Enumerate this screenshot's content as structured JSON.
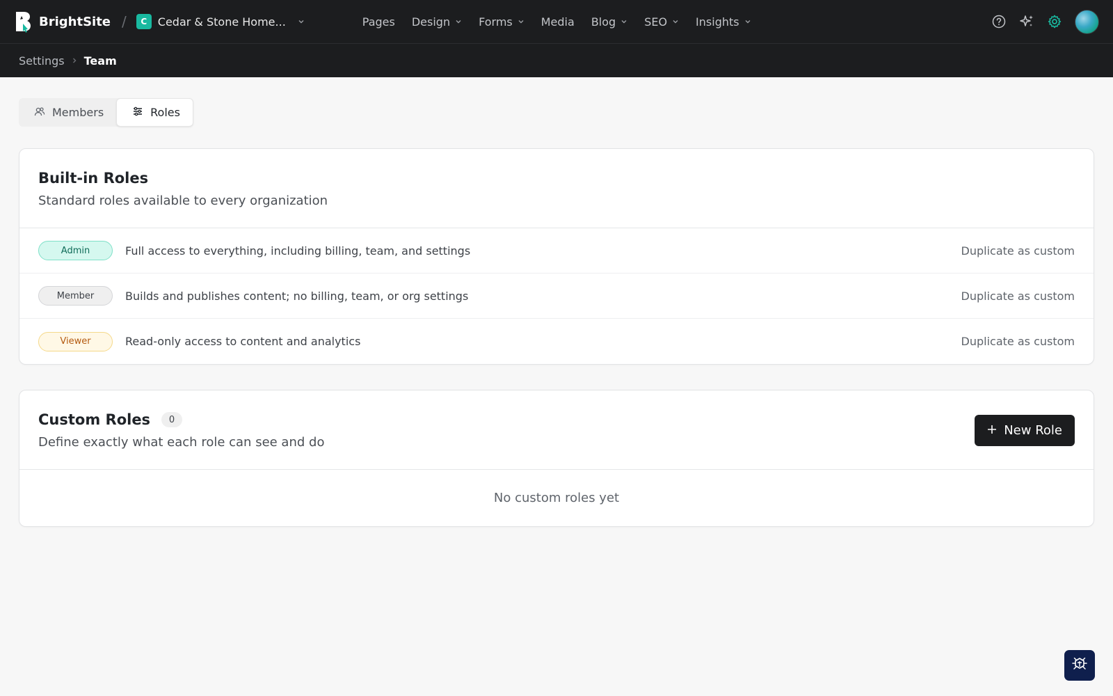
{
  "app": {
    "name": "BrightSite",
    "separator": "/"
  },
  "site": {
    "initial": "C",
    "name": "Cedar & Stone Home...",
    "accent": "#19b9a0"
  },
  "nav": {
    "items": [
      {
        "label": "Pages",
        "dropdown": false
      },
      {
        "label": "Design",
        "dropdown": true
      },
      {
        "label": "Forms",
        "dropdown": true
      },
      {
        "label": "Media",
        "dropdown": false
      },
      {
        "label": "Blog",
        "dropdown": true
      },
      {
        "label": "SEO",
        "dropdown": true
      },
      {
        "label": "Insights",
        "dropdown": true
      }
    ]
  },
  "toolbar_icons": [
    "help-icon",
    "sparkles-icon",
    "gear-icon",
    "user-avatar"
  ],
  "breadcrumb": {
    "parent": "Settings",
    "current": "Team"
  },
  "tabs": [
    {
      "label": "Members",
      "icon": "users-icon",
      "active": false
    },
    {
      "label": "Roles",
      "icon": "sliders-icon",
      "active": true
    }
  ],
  "builtin": {
    "title": "Built-in Roles",
    "subtitle": "Standard roles available to every organization",
    "roles": [
      {
        "name": "Admin",
        "description": "Full access to everything, including billing, team, and settings",
        "action": "Duplicate as custom",
        "bg": "#d5f8ef",
        "border": "#7fe0c8",
        "color": "#0f6b58"
      },
      {
        "name": "Member",
        "description": "Builds and publishes content; no billing, team, or org settings",
        "action": "Duplicate as custom",
        "bg": "#efefef",
        "border": "#d4d5d8",
        "color": "#3e4248"
      },
      {
        "name": "Viewer",
        "description": "Read-only access to content and analytics",
        "action": "Duplicate as custom",
        "bg": "#fff8e6",
        "border": "#f5d98a",
        "color": "#b45a10"
      }
    ]
  },
  "custom": {
    "title": "Custom Roles",
    "count": "0",
    "subtitle": "Define exactly what each role can see and do",
    "button_label": "New Role",
    "empty_text": "No custom roles yet"
  },
  "colors": {
    "topbar": "#1c1d1f",
    "background": "#f7f7f7",
    "accent": "#19b9a0"
  }
}
